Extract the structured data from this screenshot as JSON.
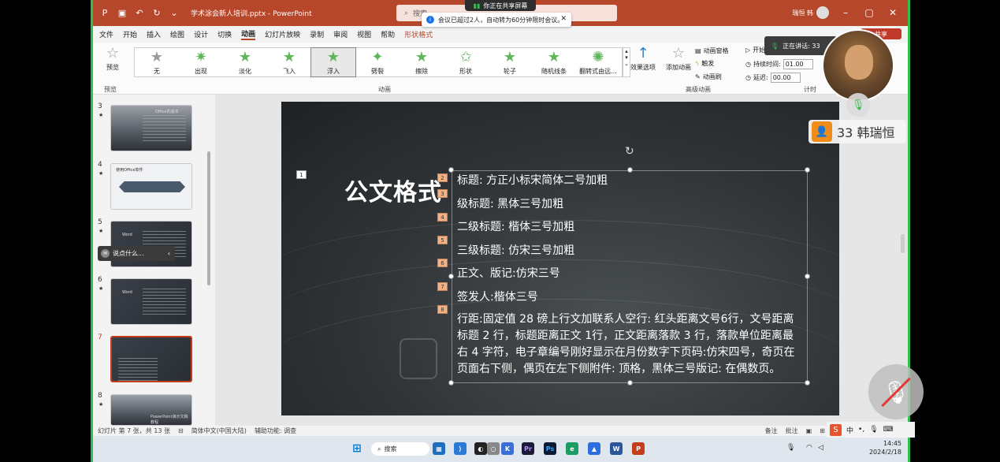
{
  "window": {
    "file_title": "学术涂会新人培训.pptx - PowerPoint",
    "search_placeholder": "搜索",
    "user_name": "瑞恒 韩",
    "colors": {
      "accent": "#b7472a",
      "share_border": "#2bc04f"
    }
  },
  "share": {
    "banner": "你正在共享屏幕",
    "notice": "会议已超过2人，自动转为60分钟限时会议。"
  },
  "menu": {
    "tabs": [
      "文件",
      "开始",
      "插入",
      "绘图",
      "设计",
      "切换",
      "动画",
      "幻灯片放映",
      "录制",
      "审阅",
      "视图",
      "帮助",
      "形状格式"
    ],
    "active": "动画"
  },
  "ribbon": {
    "preview_label": "预览",
    "preview_group": "预览",
    "animation_group": "动画",
    "animations": [
      "无",
      "出现",
      "淡化",
      "飞入",
      "浮入",
      "劈裂",
      "擦除",
      "形状",
      "轮子",
      "随机线条",
      "翻转式由远..."
    ],
    "selected_animation": "浮入",
    "effect_options": "效果选项",
    "add_animation": "添加动画",
    "animation_pane": "动画窗格",
    "trigger": "触发",
    "animation_painter": "动画刷",
    "advanced_group": "高级动画",
    "start_label": "开始",
    "duration_label": "持续时间:",
    "duration_value": "01.00",
    "delay_label": "延迟:",
    "delay_value": "00.00",
    "timing_group": "计时"
  },
  "thumbnails": {
    "items": [
      {
        "num": "3",
        "label": "Office的版本"
      },
      {
        "num": "4",
        "label": "使用Office软件"
      },
      {
        "num": "5",
        "label": "Word"
      },
      {
        "num": "6",
        "label": "Word"
      },
      {
        "num": "7",
        "label": ""
      },
      {
        "num": "8",
        "label": "PowerPoint演示文稿教程"
      }
    ],
    "star": "★",
    "toast": "说点什么..."
  },
  "slide": {
    "title": "公文格式",
    "tag_title": "1",
    "lines": [
      {
        "tag": "2",
        "text": "标题: 方正小标宋简体二号加粗"
      },
      {
        "tag": "3",
        "text": "级标题: 黑体三号加粗"
      },
      {
        "tag": "4",
        "text": "二级标题: 楷体三号加粗"
      },
      {
        "tag": "5",
        "text": "三级标题: 仿宋三号加粗"
      },
      {
        "tag": "6",
        "text": "正文、版记:仿宋三号"
      },
      {
        "tag": "7",
        "text": "签发人:楷体三号"
      }
    ],
    "para_tag": "8",
    "paragraph": "行距:固定值 28 磅上行文加联系人空行: 红头距离文号6行，文号距离标题 2 行，标题距离正文 1行，正文距离落款 3 行，落款单位距离最右 4 字符，电子章编号刚好显示在月份数字下页码:仿宋四号，奇页在页面右下侧，偶页在左下侧附件: 顶格，黑体三号版记: 在偶数页。"
  },
  "status": {
    "slide_info": "幻灯片 第 7 张，共 13 张",
    "language": "简体中文(中国大陆)",
    "accessibility": "辅助功能: 调查",
    "notes": "备注",
    "comments": "批注"
  },
  "taskbar": {
    "search": "搜索",
    "time": "14:45",
    "date": "2024/2/18",
    "ime": "中"
  },
  "meeting": {
    "speaking": "正在讲话: 33",
    "share_btn": "共享",
    "participant": "33 韩瑞恒"
  }
}
